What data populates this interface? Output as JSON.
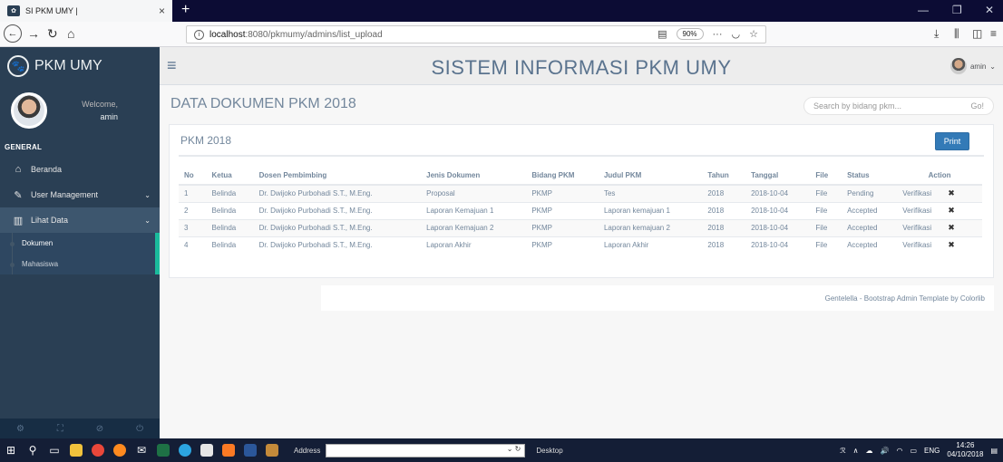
{
  "browser": {
    "tab_title": "SI PKM UMY |",
    "tab_close": "×",
    "new_tab": "+",
    "url_host": "localhost",
    "url_path": ":8080/pkmumy/admins/list_upload",
    "zoom": "90%",
    "more": "···"
  },
  "sidebar": {
    "brand": "PKM UMY",
    "welcome": "Welcome,",
    "username": "amin",
    "section": "GENERAL",
    "items": [
      {
        "label": "Beranda",
        "icon": "home-icon"
      },
      {
        "label": "User Management",
        "icon": "edit-icon"
      },
      {
        "label": "Lihat Data",
        "icon": "bar-chart-icon"
      }
    ],
    "subitems": [
      "Dokumen",
      "Mahasiswa"
    ]
  },
  "topnav": {
    "site_title": "SISTEM INFORMASI PKM UMY",
    "user": "amin"
  },
  "page": {
    "title": "DATA DOKUMEN PKM 2018",
    "search_placeholder": "Search by bidang pkm...",
    "search_go": "Go!"
  },
  "panel": {
    "title": "PKM 2018",
    "print_label": "Print"
  },
  "table": {
    "headers": [
      "No",
      "Ketua",
      "Dosen Pembimbing",
      "Jenis Dokumen",
      "Bidang PKM",
      "Judul PKM",
      "Tahun",
      "Tanggal",
      "File",
      "Status",
      "Action"
    ],
    "rows": [
      {
        "no": "1",
        "ketua": "Belinda",
        "dosen": "Dr. Dwijoko Purbohadi S.T., M.Eng.",
        "jenis": "Proposal",
        "bidang": "PKMP",
        "judul": "Tes",
        "tahun": "2018",
        "tanggal": "2018-10-04",
        "file": "File",
        "status": "Pending",
        "action": "Verifikasi"
      },
      {
        "no": "2",
        "ketua": "Belinda",
        "dosen": "Dr. Dwijoko Purbohadi S.T., M.Eng.",
        "jenis": "Laporan Kemajuan 1",
        "bidang": "PKMP",
        "judul": "Laporan kemajuan 1",
        "tahun": "2018",
        "tanggal": "2018-10-04",
        "file": "File",
        "status": "Accepted",
        "action": "Verifikasi"
      },
      {
        "no": "3",
        "ketua": "Belinda",
        "dosen": "Dr. Dwijoko Purbohadi S.T., M.Eng.",
        "jenis": "Laporan Kemajuan 2",
        "bidang": "PKMP",
        "judul": "Laporan kemajuan 2",
        "tahun": "2018",
        "tanggal": "2018-10-04",
        "file": "File",
        "status": "Accepted",
        "action": "Verifikasi"
      },
      {
        "no": "4",
        "ketua": "Belinda",
        "dosen": "Dr. Dwijoko Purbohadi S.T., M.Eng.",
        "jenis": "Laporan Akhir",
        "bidang": "PKMP",
        "judul": "Laporan Akhir",
        "tahun": "2018",
        "tanggal": "2018-10-04",
        "file": "File",
        "status": "Accepted",
        "action": "Verifikasi"
      }
    ]
  },
  "footer": {
    "text": "Gentelella - Bootstrap Admin Template by Colorlib"
  },
  "taskbar": {
    "address_label": "Address",
    "desktop_label": "Desktop",
    "lang": "ENG",
    "time": "14:26",
    "date": "04/10/2018"
  },
  "colors": {
    "sidebar": "#2a3f54",
    "accent": "#1abb9c",
    "primary": "#337ab7"
  }
}
